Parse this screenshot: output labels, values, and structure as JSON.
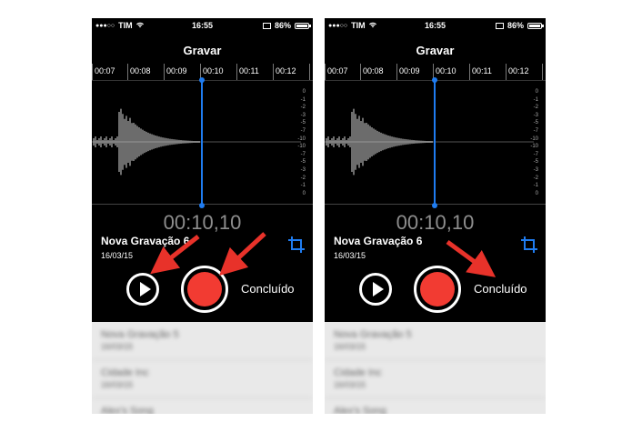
{
  "phones": [
    {
      "status": {
        "carrier": "TIM",
        "time": "16:55",
        "battery": "86%",
        "battery_level": 0.86
      },
      "title": "Gravar",
      "timeline_labels": [
        "00:07",
        "00:08",
        "00:09",
        "00:10",
        "00:11",
        "00:12"
      ],
      "db_scale": [
        "0",
        "-1",
        "-2",
        "-3",
        "-5",
        "-7",
        "-10",
        "-10",
        "-7",
        "-5",
        "-3",
        "-2",
        "-1",
        "0"
      ],
      "elapsed": "00:10,10",
      "recording": {
        "name": "Nova Gravação 6",
        "date": "16/03/15"
      },
      "done_label": "Concluído",
      "list": [
        {
          "name": "Nova Gravação 5",
          "meta": "16/03/15"
        },
        {
          "name": "Cidade Inc",
          "meta": "16/03/15"
        },
        {
          "name": "Alex's Song",
          "meta": ""
        }
      ]
    },
    {
      "status": {
        "carrier": "TIM",
        "time": "16:55",
        "battery": "86%",
        "battery_level": 0.86
      },
      "title": "Gravar",
      "timeline_labels": [
        "00:07",
        "00:08",
        "00:09",
        "00:10",
        "00:11",
        "00:12"
      ],
      "db_scale": [
        "0",
        "-1",
        "-2",
        "-3",
        "-5",
        "-7",
        "-10",
        "-10",
        "-7",
        "-5",
        "-3",
        "-2",
        "-1",
        "0"
      ],
      "elapsed": "00:10,10",
      "recording": {
        "name": "Nova Gravação 6",
        "date": "16/03/15"
      },
      "done_label": "Concluído",
      "list": [
        {
          "name": "Nova Gravação 5",
          "meta": "16/03/15"
        },
        {
          "name": "Cidade Inc",
          "meta": "16/03/15"
        },
        {
          "name": "Alex's Song",
          "meta": ""
        }
      ]
    }
  ],
  "colors": {
    "accent_blue": "#1f7cf0",
    "record_red": "#f23b32",
    "annotation_red": "#e8322a"
  },
  "icons": {
    "crop": "crop-icon",
    "play": "play-icon",
    "record": "record-icon",
    "wifi": "wifi-icon",
    "airplay": "airplay-icon"
  }
}
